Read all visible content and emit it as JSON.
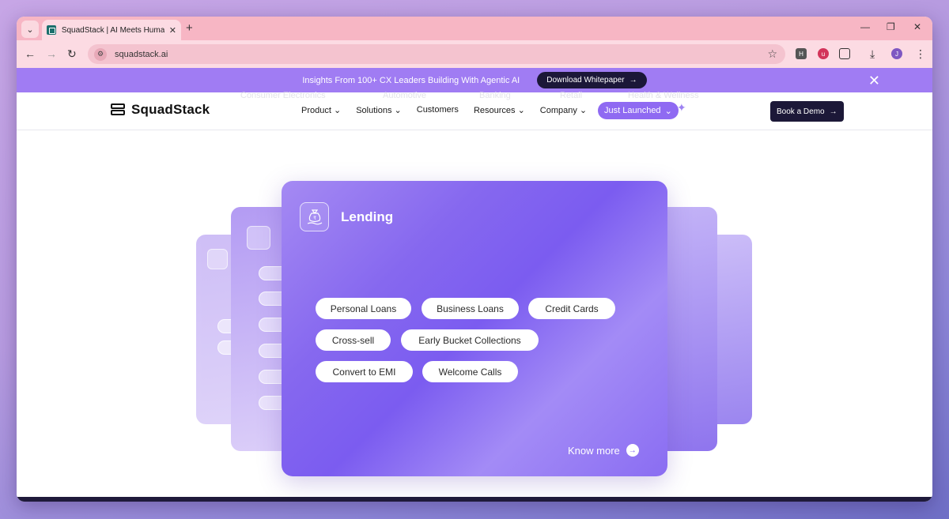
{
  "browser": {
    "tab_title": "SquadStack | AI Meets Human E",
    "url": "squadstack.ai",
    "profile_initial": "J"
  },
  "banner": {
    "text": "Insights From 100+ CX Leaders Building With Agentic AI",
    "button_label": "Download Whitepaper"
  },
  "nav": {
    "ghost_categories": [
      "Consumer Electronics",
      "Automotive",
      "Banking",
      "Retail",
      "Health & Wellness"
    ],
    "logo_text": "SquadStack",
    "menu": [
      "Product",
      "Solutions",
      "Customers",
      "Resources",
      "Company"
    ],
    "just_launched": "Just Launched",
    "book_demo": "Book a Demo"
  },
  "card": {
    "title": "Lending",
    "chips": [
      "Personal Loans",
      "Business Loans",
      "Credit Cards",
      "Cross-sell",
      "Early Bucket Collections",
      "Convert to EMI",
      "Welcome Calls"
    ],
    "know_more": "Know more"
  },
  "colors": {
    "banner": "#a07cf3",
    "card_accent": "#7b5cf0",
    "dark": "#1c1838"
  }
}
